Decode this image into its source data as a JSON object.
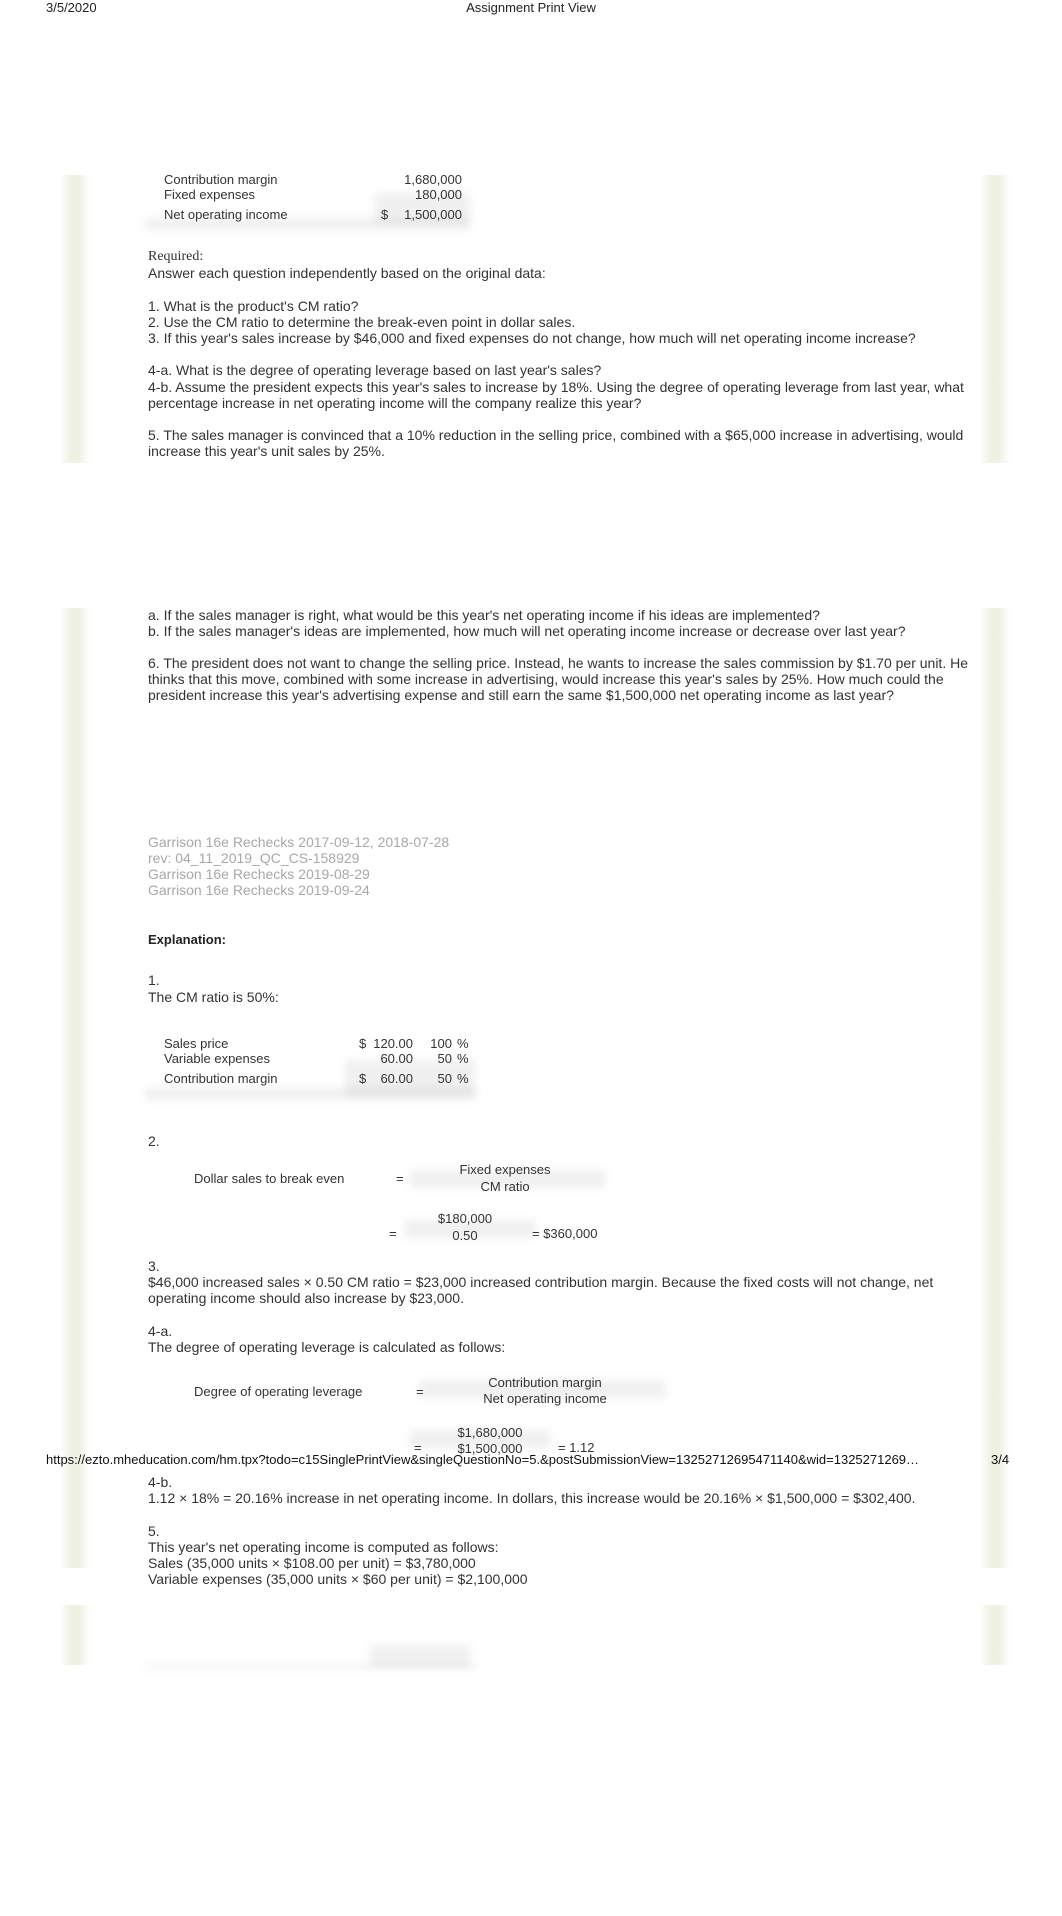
{
  "header": {
    "date": "3/5/2020",
    "title": "Assignment Print View"
  },
  "income_statement_tail": {
    "rows": [
      {
        "label": "Contribution margin",
        "currency": "",
        "value": "1,680,000"
      },
      {
        "label": "Fixed expenses",
        "currency": "",
        "value": "180,000"
      },
      {
        "label": "Net operating income",
        "currency": "$",
        "value": "1,500,000"
      }
    ]
  },
  "required": {
    "heading": "Required:",
    "intro": "Answer each question independently based on the original data:",
    "q1": "1. What is the product's CM ratio?",
    "q2": "2. Use the CM ratio to determine the break-even point in dollar sales.",
    "q3": "3. If this year's sales increase by $46,000 and fixed expenses do not change, how much will net operating income increase?",
    "q4a": "4-a. What is the degree of operating leverage based on last year's sales?",
    "q4b_line1": "4-b. Assume the president expects this year's sales to increase by 18%. Using the degree of operating leverage from last year, what",
    "q4b_line2": "percentage increase in net operating income will the company realize this year?",
    "q5_line1": "5. The sales manager is convinced that a 10% reduction in the selling price, combined with a $65,000 increase in advertising, would",
    "q5_line2": "increase this year's unit sales by 25%.",
    "q5a": "a. If the sales manager is right, what would be this year's net operating income if his ideas are implemented?",
    "q5b": "b. If the sales manager's ideas are implemented, how much will net operating income increase or decrease over last year?",
    "q6_line1": "6. The president does not want to change the selling price. Instead, he wants to increase the sales commission by $1.70 per unit. He",
    "q6_line2": "thinks that this move, combined with some increase in advertising, would increase this year's sales by 25%. How much could the",
    "q6_line3": "president increase this year's advertising expense and still earn the same $1,500,000 net operating income as last year?"
  },
  "revisions": [
    "Garrison 16e Rechecks 2017-09-12, 2018-07-28",
    "rev: 04_11_2019_QC_CS-158929",
    "Garrison 16e Rechecks 2019-08-29",
    "Garrison 16e Rechecks 2019-09-24"
  ],
  "explanation": {
    "heading": "Explanation:",
    "s1": {
      "number": "1.",
      "text": "The CM ratio is 50%:",
      "rows": [
        {
          "label": "Sales price",
          "currency": "$",
          "amount": "120.00",
          "percent": "100",
          "pct_sign": "%"
        },
        {
          "label": "Variable expenses",
          "currency": "",
          "amount": "60.00",
          "percent": "50",
          "pct_sign": "%"
        },
        {
          "label": "Contribution margin",
          "currency": "$",
          "amount": "60.00",
          "percent": "50",
          "pct_sign": "%"
        }
      ]
    },
    "s2": {
      "number": "2.",
      "label": "Dollar sales to break even",
      "eq": "=",
      "numerator": "Fixed expenses",
      "denominator": "CM ratio",
      "eq2": "=",
      "num_value": "$180,000",
      "den_value": "0.50",
      "result": "= $360,000"
    },
    "s3": {
      "number": "3.",
      "line1": "$46,000 increased sales × 0.50 CM ratio = $23,000 increased contribution margin. Because the fixed costs will not change, net",
      "line2": "operating income should also increase by $23,000."
    },
    "s4a": {
      "number": "4-a.",
      "text": "The degree of operating leverage is calculated as follows:",
      "label": "Degree of operating leverage",
      "eq": "=",
      "numerator": "Contribution margin",
      "denominator": "Net operating income",
      "eq2": "=",
      "num_value": "$1,680,000",
      "den_value": "$1,500,000",
      "result": "= 1.12"
    },
    "s4b": {
      "number": "4-b.",
      "text": "1.12 × 18% = 20.16% increase in net operating income. In dollars, this increase would be 20.16% × $1,500,000 = $302,400."
    },
    "s5": {
      "number": "5.",
      "line1": "This year's net operating income is computed as follows:",
      "line2": "Sales (35,000 units × $108.00 per unit) = $3,780,000",
      "line3": "Variable expenses (35,000 units × $60 per unit) = $2,100,000"
    }
  },
  "footer": {
    "url": "https://ezto.mheducation.com/hm.tpx?todo=c15SinglePrintView&singleQuestionNo=5.&postSubmissionView=13252712695471140&wid=1325271269…",
    "page": "3/4"
  }
}
